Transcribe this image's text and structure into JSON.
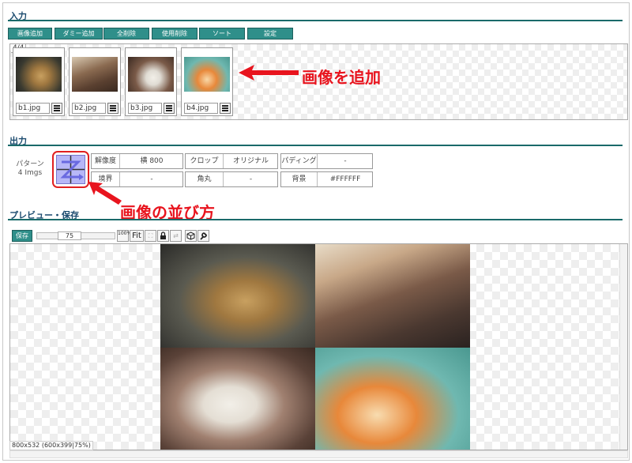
{
  "sections": {
    "input": "入力",
    "output": "出力",
    "preview": "プレビュー・保存"
  },
  "toolbar": {
    "add_images": "画像追加",
    "add_dummy": "ダミー追加",
    "delete_all": "全削除",
    "delete_used": "使用削除",
    "sort": "ソート",
    "settings": "設定"
  },
  "thumbnails": {
    "count": "4/4",
    "items": [
      {
        "filename": "b1.jpg",
        "color_a": "#5a4a30",
        "color_b": "#c8a060"
      },
      {
        "filename": "b2.jpg",
        "color_a": "#6b4a3a",
        "color_b": "#e0c8a8"
      },
      {
        "filename": "b3.jpg",
        "color_a": "#4a3a30",
        "color_b": "#e8e4e0"
      },
      {
        "filename": "b4.jpg",
        "color_a": "#5fb0a8",
        "color_b": "#e8883a"
      }
    ]
  },
  "annotations": {
    "add_image": "画像を追加",
    "image_arrangement": "画像の並び方"
  },
  "output": {
    "pattern_label": "パターン",
    "pattern_imgs": "4 Imgs",
    "resolution_label": "解像度",
    "resolution_value": "横 800",
    "crop_label": "クロップ",
    "crop_value": "オリジナル",
    "padding_label": "パディング",
    "padding_value": "-",
    "border_label": "境界",
    "border_value": "-",
    "corner_label": "角丸",
    "corner_value": "-",
    "background_label": "背景",
    "background_value": "#FFFFFF"
  },
  "preview": {
    "save": "保存",
    "zoom_value": "75",
    "btn_100": "100%",
    "btn_fit": "Fit",
    "size_info": "800x532 (600x399|75%)"
  },
  "colors": {
    "accent": "#2f8f8a",
    "annotation": "#e8141e",
    "section_line": "#1a6a6a"
  }
}
